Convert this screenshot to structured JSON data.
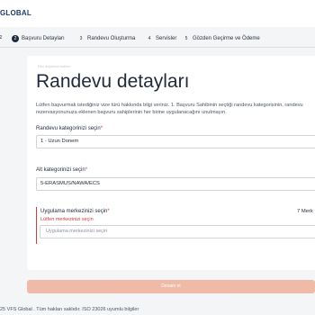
{
  "header": {
    "logo_text": "GLOBAL"
  },
  "steps": [
    {
      "num": "",
      "label": "iz"
    },
    {
      "num": "2",
      "label": "Başvuru Detayları"
    },
    {
      "num": "3",
      "label": "Randevu Oluşturma"
    },
    {
      "num": "4",
      "label": "Servisler"
    },
    {
      "num": "5",
      "label": "Gözden Geçirme ve Ödeme"
    }
  ],
  "card": {
    "caption": "Eko dağıtıma katılım",
    "title": "Randevu detayları",
    "intro": "Lütfen başvurmak istediğiniz vize türü hakkında bilgi veriniz. 1. Başvuru Sahibinin seçtiği randevu kategorisinin, randevu rezervasyonunuza eklenen başvuru sahiplerinin her birine uygulanacağını unutmayın.",
    "category_label": "Randevu kategorinizi seçin",
    "category_value": "1 - Uzun Donem",
    "subcategory_label": "Alt kategorinizi seçin",
    "subcategory_value": "5-ERASMUS/NAWA/ECS",
    "center_label": "Uygulama merkezinizi seçin",
    "center_error": "Lütfen merkezinizi seçin",
    "center_placeholder": "Uygulama merkezinizi seçin",
    "side_note": "7 Merk",
    "required_mark": "*"
  },
  "actions": {
    "continue_label": "Devam et"
  },
  "footer": {
    "text": "25 VFS Global . Tüm hakları saklıdır. ISO 23026 uyumlu bilgiler"
  },
  "colors": {
    "accent": "#f0b49e",
    "error": "#d33a3a",
    "text": "#1f2a3a"
  }
}
